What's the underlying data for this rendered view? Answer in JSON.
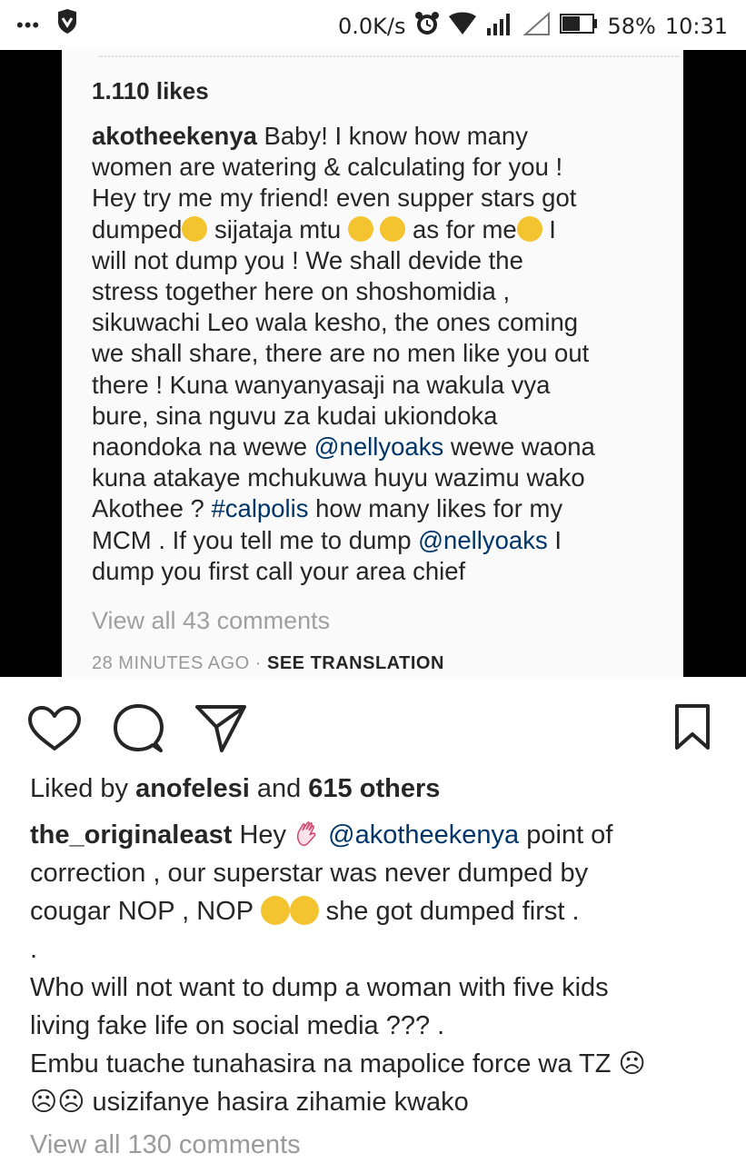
{
  "status": {
    "dots": "•••",
    "speed": "0.0K/s",
    "battery": "58%",
    "time": "10:31"
  },
  "screenshot": {
    "likes": "1.110 likes",
    "username": "akotheekenya",
    "caption_lines": [
      "Baby! I know how many",
      "women are watering & calculating for you !",
      "Hey try me my friend! even supper stars got",
      "dumped",
      " sijataja mtu ",
      "  as for me",
      " I",
      "will not dump you ! We shall devide the",
      "stress together here on shoshomidia ,",
      "sikuwachi Leo wala kesho, the ones coming",
      "we shall share,  there are no men like you out",
      "there ! Kuna wanyanyasaji na wakula vya",
      "bure, sina nguvu za kudai  ukiondoka",
      "naondoka na wewe ",
      "@nellyoaks",
      " wewe waona",
      "kuna atakaye mchukuwa huyu wazimu wako",
      "Akothee ? ",
      "#calpolis",
      " how many likes for my",
      "MCM . If you tell me to dump ",
      "@nellyoaks",
      " I",
      "dump you first call your area chief"
    ],
    "view_all": "View all 43 comments",
    "time_ago": "28 MINUTES AGO",
    "separator": " · ",
    "see_translation": "SEE TRANSLATION"
  },
  "actions": {
    "like": "heart-icon",
    "comment": "comment-icon",
    "share": "send-icon",
    "save": "bookmark-icon"
  },
  "liked_by": {
    "prefix": "Liked by ",
    "user": "anofelesi",
    "middle": " and ",
    "count": "615 others"
  },
  "comment": {
    "username": "the_originaleast",
    "t1": " Hey ",
    "mention": "@akotheekenya",
    "t2": "  point of",
    "line2": "correction , our superstar was never dumped by",
    "line3a": "cougar NOP , NOP ",
    "line3b": " she got dumped first .",
    "line4": ".",
    "line5": "Who will not want to dump a woman with five kids",
    "line6": "living fake life on social media ??? .",
    "line7": "Embu tuache tunahasira na mapolice force wa TZ ☹",
    "line8": "☹☹ usizifanye hasira zihamie kwako"
  },
  "view_all_comments": "View all 130 comments"
}
